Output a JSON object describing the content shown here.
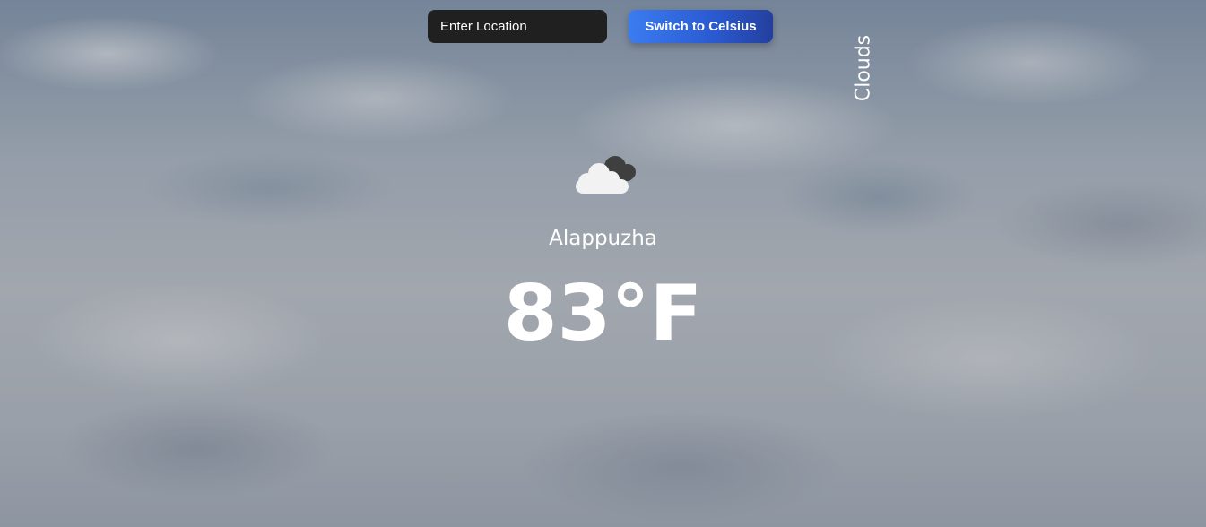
{
  "search": {
    "placeholder": "Enter Location",
    "value": ""
  },
  "unit_toggle": {
    "label": "Switch to Celsius"
  },
  "weather": {
    "condition": "Clouds",
    "icon": "clouds-icon",
    "city": "Alappuzha",
    "temperature": "83°F"
  },
  "colors": {
    "input_background": "#202020",
    "button_gradient_start": "#3b7cf0",
    "button_gradient_end": "#243f9d",
    "text": "#ffffff"
  }
}
